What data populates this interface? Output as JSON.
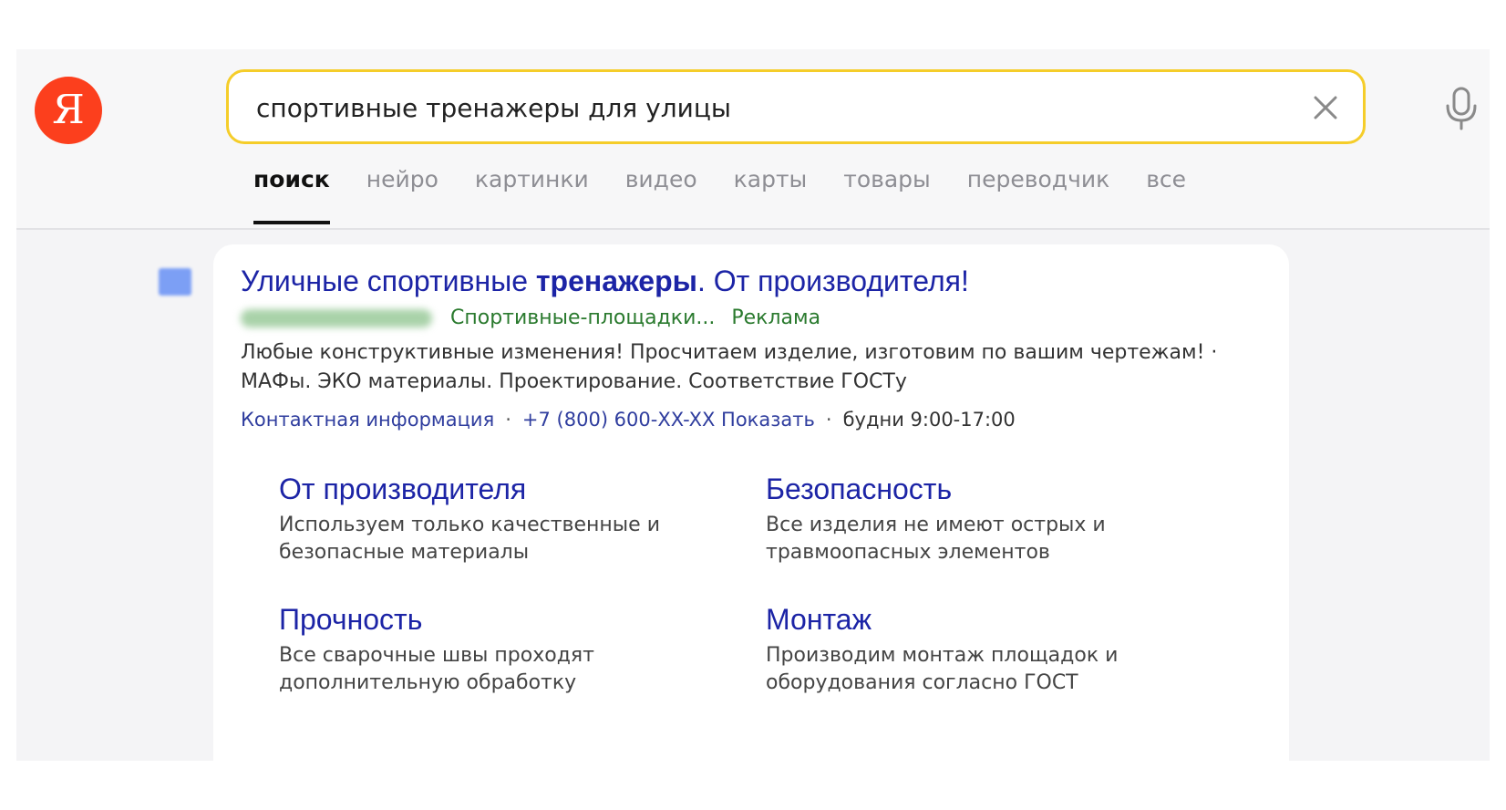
{
  "header": {
    "logo_letter": "Я",
    "search": {
      "value": "спортивные тренажеры для улицы",
      "placeholder": ""
    },
    "clear_icon": "close-icon",
    "mic_icon": "microphone-icon"
  },
  "tabs": [
    {
      "label": "поиск",
      "active": true
    },
    {
      "label": "нейро",
      "active": false
    },
    {
      "label": "картинки",
      "active": false
    },
    {
      "label": "видео",
      "active": false
    },
    {
      "label": "карты",
      "active": false
    },
    {
      "label": "товары",
      "active": false
    },
    {
      "label": "переводчик",
      "active": false
    },
    {
      "label": "все",
      "active": false
    }
  ],
  "ad": {
    "title_part1": "Уличные спортивные ",
    "title_bold": "тренажеры",
    "title_part2": ". От производителя!",
    "url_path": "Спортивные-площадки...",
    "ad_label": "Реклама",
    "description": "Любые конструктивные изменения! Просчитаем изделие, изготовим по вашим чертежам! · МАФы. ЭКО материалы. Проектирование. Соответствие ГОСТу",
    "contacts": {
      "contact_link": "Контактная информация",
      "phone": "+7 (800) 600-XX-XX Показать",
      "hours": "будни 9:00-17:00"
    },
    "sitelinks": [
      {
        "title": "От производителя",
        "desc": "Используем только качественные и безопасные материалы"
      },
      {
        "title": "Безопасность",
        "desc": "Все изделия не имеют острых и травмоопасных элементов"
      },
      {
        "title": "Прочность",
        "desc": "Все сварочные швы проходят дополнительную обработку"
      },
      {
        "title": "Монтаж",
        "desc": "Производим монтаж площадок и оборудования согласно ГОСТ"
      }
    ]
  },
  "colors": {
    "logo": "#fc3f1d",
    "search_border": "#f5cd2a",
    "link": "#1c24a6",
    "url_green": "#2a7a2e"
  }
}
